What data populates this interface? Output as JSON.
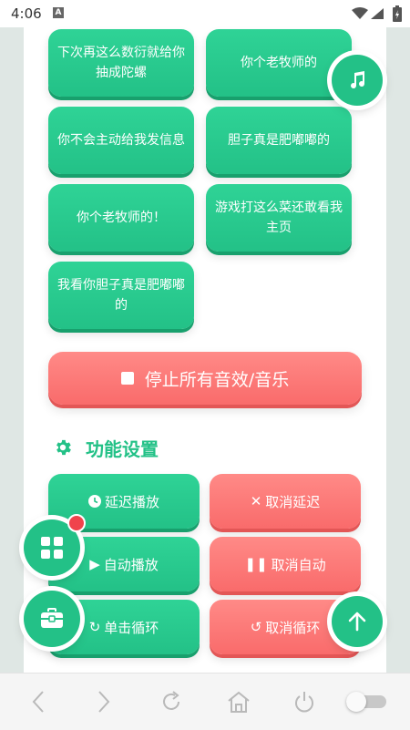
{
  "status": {
    "time": "4:06",
    "a_badge": "A"
  },
  "sounds": [
    {
      "label": "下次再这么数衍就给你抽成陀螺"
    },
    {
      "label": "你个老牧师的"
    },
    {
      "label": "你不会主动给我发信息"
    },
    {
      "label": "胆子真是肥嘟嘟的"
    },
    {
      "label": "你个老牧师的！"
    },
    {
      "label": "游戏打这么菜还敢看我主页"
    },
    {
      "label": "我看你胆子真是肥嘟嘟的"
    }
  ],
  "stop_button": {
    "label": "停止所有音效/音乐"
  },
  "settings": {
    "title": "功能设置",
    "delay_play": "延迟播放",
    "cancel_delay": "取消延迟",
    "auto_play": "自动播放",
    "cancel_auto": "取消自动",
    "single_loop": "单击循环",
    "cancel_loop": "取消循环"
  },
  "colors": {
    "green": "#23c187",
    "red": "#f96b6b",
    "badge": "#f0434c"
  },
  "icons": {
    "music": "music-note-icon",
    "grid": "grid-icon",
    "toolbox": "toolbox-icon",
    "up": "arrow-up-icon",
    "settings": "gear-icon"
  }
}
